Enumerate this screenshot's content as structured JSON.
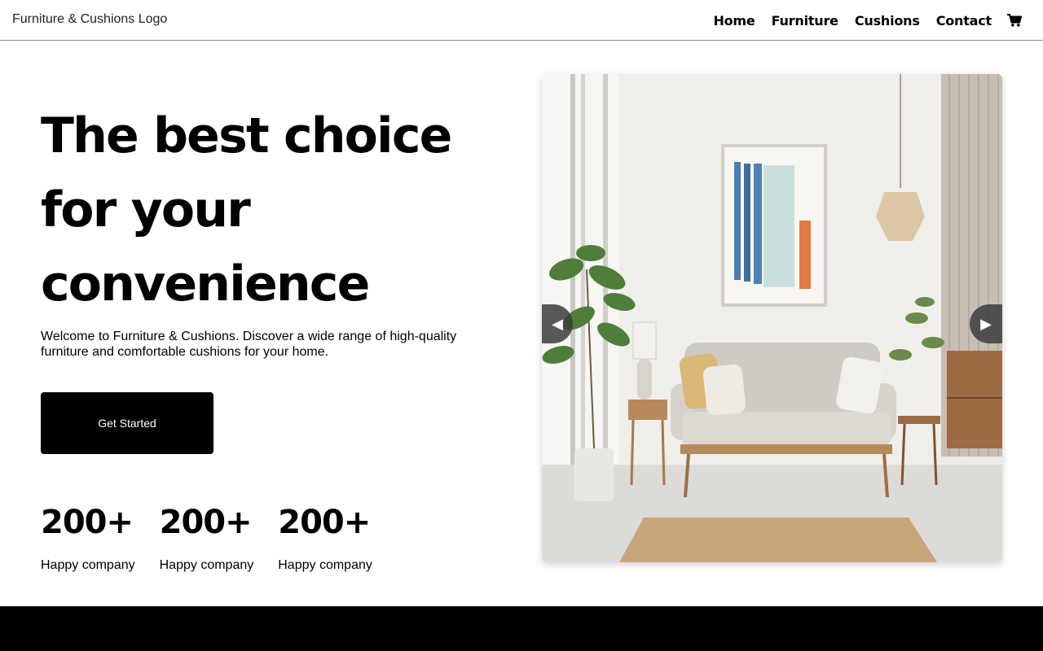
{
  "header": {
    "logo_alt": "Furniture & Cushions Logo",
    "nav": [
      "Home",
      "Furniture",
      "Cushions",
      "Contact"
    ],
    "cart_icon": "cart-icon"
  },
  "hero": {
    "title_lines": [
      "The best choice",
      "for your",
      "convenience"
    ],
    "description": "Welcome to Furniture & Cushions. Discover a wide range of high-quality furniture and comfortable cushions for your home.",
    "cta_label": "Get Started"
  },
  "stats": [
    {
      "value": "200+",
      "label": "Happy company"
    },
    {
      "value": "200+",
      "label": "Happy company"
    },
    {
      "value": "200+",
      "label": "Happy company"
    }
  ],
  "carousel": {
    "prev_symbol": "◀",
    "next_symbol": "▶"
  },
  "colors": {
    "primary": "#000000",
    "background": "#ffffff",
    "header_border": "#8a8a8a"
  }
}
